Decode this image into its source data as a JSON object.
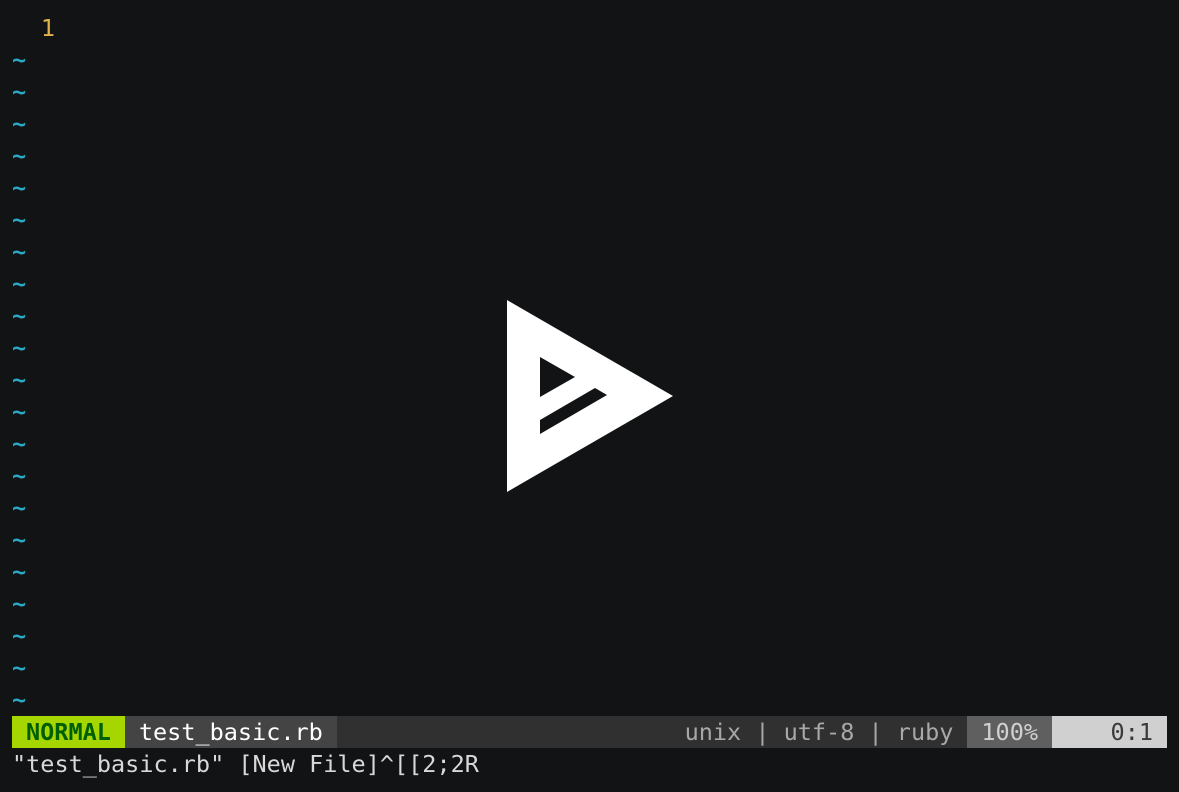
{
  "editor": {
    "first_line_number": "1",
    "tilde": "~",
    "empty_line_count": 21
  },
  "statusline": {
    "mode": "NORMAL",
    "filename": "test_basic.rb",
    "fileinfo": "unix | utf-8 | ruby",
    "percent": "100%",
    "position": "0:1"
  },
  "cmdline": {
    "text": "\"test_basic.rb\" [New File]^[[2;2R"
  },
  "overlay": {
    "icon": "asciinema-play-icon"
  },
  "colors": {
    "background": "#121314",
    "line_number": "#e0b34a",
    "tilde": "#2aa8c8",
    "mode_bg": "#a6d600",
    "mode_fg": "#005f00"
  }
}
